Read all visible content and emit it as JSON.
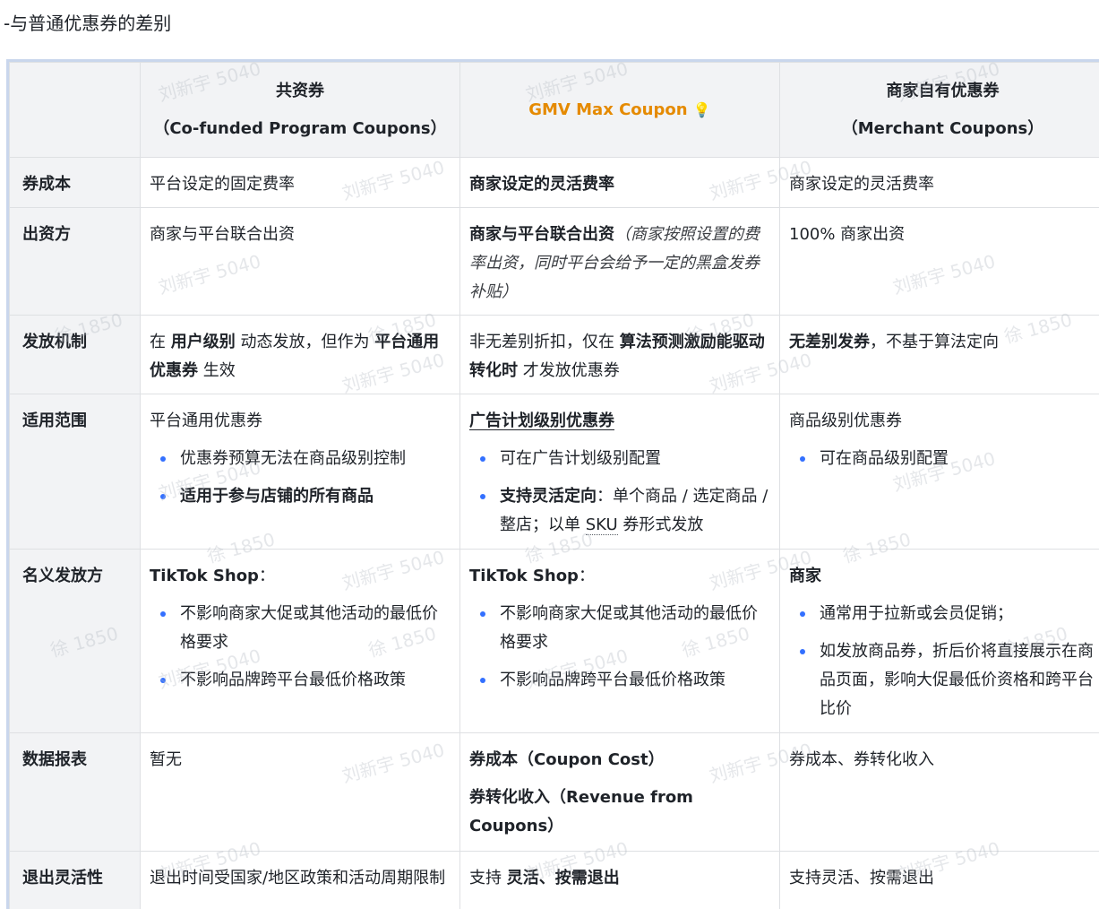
{
  "heading": "-与普通优惠券的差别",
  "columns": {
    "col1_line1": "共资券",
    "col1_line2": "（Co-funded Program Coupons）",
    "col2_line1": "GMV Max Coupon",
    "col2_icon": "lightbulb-icon",
    "col3_line1": "商家自有优惠券",
    "col3_line2": "（Merchant Coupons）"
  },
  "rows": {
    "cost": {
      "label": "券成本",
      "c1": "平台设定的固定费率",
      "c2": "商家设定的灵活费率",
      "c3": "商家设定的灵活费率"
    },
    "funder": {
      "label": "出资方",
      "c1": "商家与平台联合出资",
      "c2_bold": "商家与平台联合出资",
      "c2_italic": "（商家按照设置的费率出资，同时平台会给予一定的黑盒发券补贴）",
      "c3": "100% 商家出资"
    },
    "mechanism": {
      "label": "发放机制",
      "c1_a": "在 ",
      "c1_b": "用户级别",
      "c1_c": " 动态发放，但作为 ",
      "c1_d": "平台通用优惠券",
      "c1_e": " 生效",
      "c2_a": "非无差别折扣，仅在 ",
      "c2_b": "算法预测激励能驱动转化时",
      "c2_c": " 才发放优惠券",
      "c3_a": "无差别发券",
      "c3_b": "，不基于算法定向"
    },
    "scope": {
      "label": "适用范围",
      "c1_title": "平台通用优惠券",
      "c1_b1": "优惠券预算无法在商品级别控制",
      "c1_b2": "适用于参与店铺的所有商品",
      "c2_title": "广告计划级别优惠券",
      "c2_b1": "可在广告计划级别配置",
      "c2_b2_bold": "支持灵活定向",
      "c2_b2_a": "：单个商品 / 选定商品 / 整店；以单 ",
      "c2_b2_sku": "SKU",
      "c2_b2_b": " 券形式发放",
      "c3_title": "商品级别优惠券",
      "c3_b1": "可在商品级别配置"
    },
    "issuer": {
      "label": "名义发放方",
      "c1_title": "TikTok Shop",
      "c1_colon": "：",
      "c1_b1": "不影响商家大促或其他活动的最低价格要求",
      "c1_b2": "不影响品牌跨平台最低价格政策",
      "c2_title": "TikTok Shop",
      "c2_colon": "：",
      "c2_b1": "不影响商家大促或其他活动的最低价格要求",
      "c2_b2": "不影响品牌跨平台最低价格政策",
      "c3_title": "商家",
      "c3_b1": "通常用于拉新或会员促销；",
      "c3_b2": "如发放商品券，折后价将直接展示在商品页面，影响大促最低价资格和跨平台比价"
    },
    "report": {
      "label": "数据报表",
      "c1": "暂无",
      "c2_p1": "券成本（Coupon Cost）",
      "c2_p2": "券转化收入（Revenue from Coupons）",
      "c3": "券成本、券转化收入"
    },
    "exit": {
      "label": "退出灵活性",
      "c1": "退出时间受国家/地区政策和活动周期限制",
      "c2_a": "支持 ",
      "c2_b": "灵活、按需退出",
      "c3": "支持灵活、按需退出"
    }
  },
  "watermarks": {
    "name": "刘新宇 5040",
    "alt": "徐 1850"
  },
  "colors": {
    "header_bg": "#f2f3f5",
    "border": "#dee0e3",
    "gmv_accent": "#e58a00",
    "bullet": "#3370ff"
  }
}
